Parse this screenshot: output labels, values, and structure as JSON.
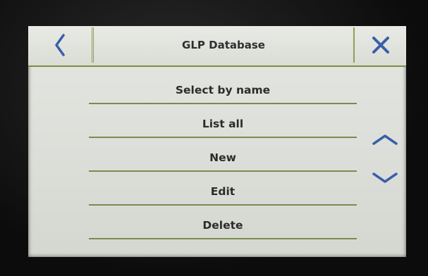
{
  "header": {
    "title": "GLP Database",
    "back_icon": "chevron-left-icon",
    "close_icon": "close-icon",
    "accent_color": "#3a5fa8"
  },
  "menu": {
    "items": [
      {
        "label": "Select by name"
      },
      {
        "label": "List all"
      },
      {
        "label": "New"
      },
      {
        "label": "Edit"
      },
      {
        "label": "Delete"
      }
    ]
  },
  "scroll": {
    "up_icon": "chevron-up-icon",
    "down_icon": "chevron-down-icon"
  }
}
